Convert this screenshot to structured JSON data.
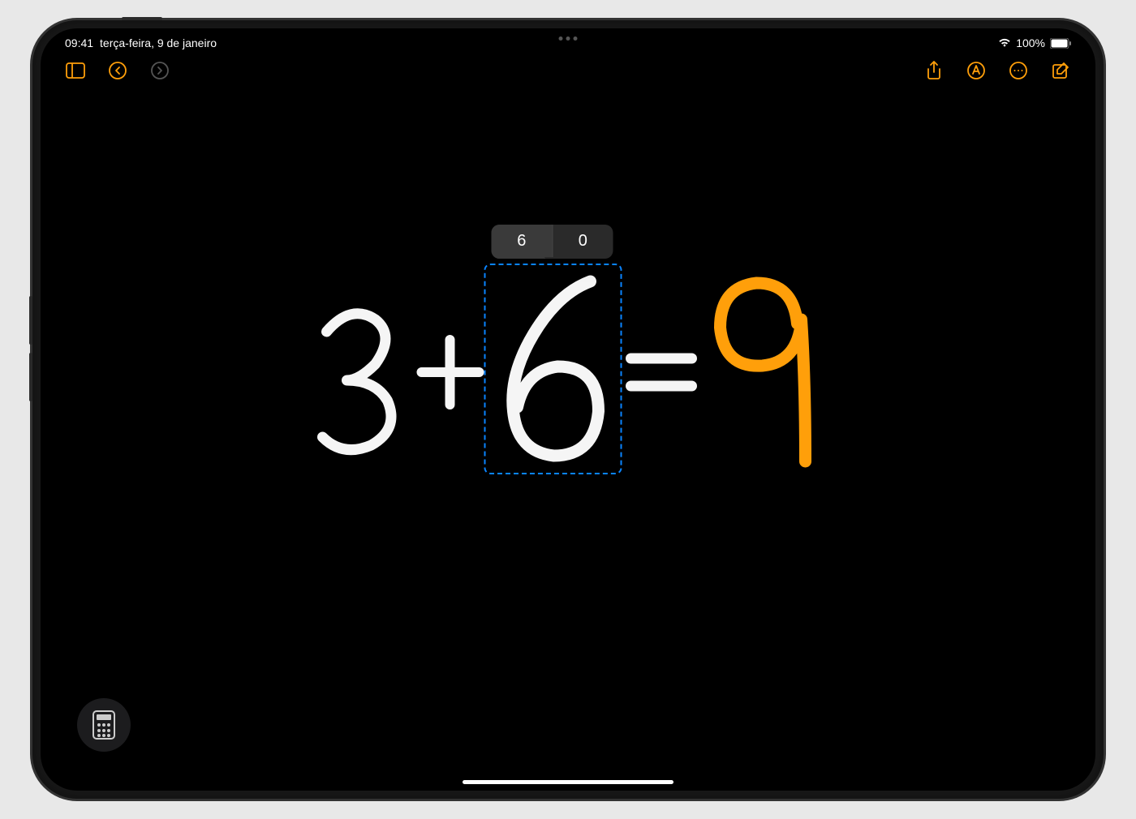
{
  "status": {
    "time": "09:41",
    "date": "terça-feira, 9 de janeiro",
    "battery": "100%"
  },
  "note": {
    "title_line1": "",
    "title_line2": ""
  },
  "equation": {
    "left_operand": "3",
    "operator": "+",
    "selected_char": "6",
    "equals": "=",
    "result": "9"
  },
  "suggestions": {
    "option1": "6",
    "option2": "0"
  },
  "colors": {
    "accent": "#ff9f0a",
    "selection": "#0a84ff",
    "ink_white": "#f5f5f5",
    "ink_orange": "#ff9f0a"
  }
}
